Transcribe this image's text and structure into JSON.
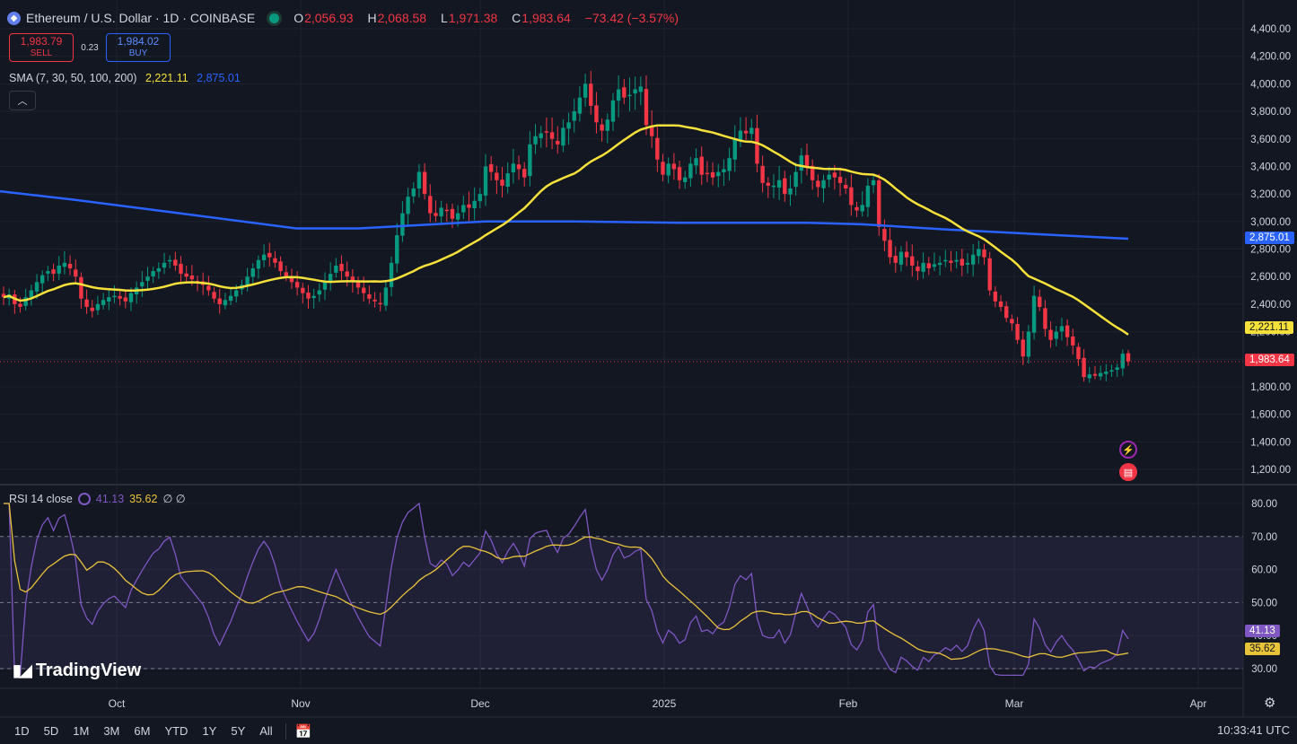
{
  "header": {
    "symbol": "Ethereum / U.S. Dollar · 1D · COINBASE",
    "ohlc": [
      {
        "k": "O",
        "v": "2,056.93"
      },
      {
        "k": "H",
        "v": "2,068.58"
      },
      {
        "k": "L",
        "v": "1,971.38"
      },
      {
        "k": "C",
        "v": "1,983.64"
      },
      {
        "k": "",
        "v": "−73.42 (−3.57%)"
      }
    ]
  },
  "trade": {
    "sell_price": "1,983.79",
    "sell_label": "SELL",
    "spread": "0.23",
    "buy_price": "1,984.02",
    "buy_label": "BUY"
  },
  "sma_legend": {
    "label": "SMA (7, 30, 50, 100, 200)",
    "v1": "2,221.11",
    "v2": "2,875.01"
  },
  "rsi_legend": {
    "label": "RSI 14 close",
    "v1": "41.13",
    "v2": "35.62",
    "extra": "∅ ∅"
  },
  "logo": {
    "text": "TradingView"
  },
  "price_axis": [
    "4,400.00",
    "4,200.00",
    "4,000.00",
    "3,800.00",
    "3,600.00",
    "3,400.00",
    "3,200.00",
    "3,000.00",
    "2,800.00",
    "2,600.00",
    "2,400.00",
    "2,200.00",
    "2,000.00",
    "1,800.00",
    "1,600.00",
    "1,400.00",
    "1,200.00"
  ],
  "rsi_axis": [
    "80.00",
    "70.00",
    "60.00",
    "50.00",
    "40.00",
    "30.00"
  ],
  "time_axis": [
    "Oct",
    "Nov",
    "Dec",
    "2025",
    "Feb",
    "Mar",
    "Apr"
  ],
  "price_badges": {
    "sma_long": "2,875.01",
    "sma_short": "2,221.11",
    "last": "1,983.64"
  },
  "rsi_badges": {
    "rsi": "41.13",
    "ma": "35.62"
  },
  "ranges": [
    "1D",
    "5D",
    "1M",
    "3M",
    "6M",
    "YTD",
    "1Y",
    "5Y",
    "All"
  ],
  "clock": "10:33:41 UTC",
  "colors": {
    "up": "#089981",
    "down": "#f23645",
    "sma_short": "#f5e13a",
    "sma_long": "#2962ff",
    "rsi": "#7e57c2",
    "rsi_ma": "#e8c33a"
  },
  "icons": {
    "collapse": "chevron-up-icon",
    "calendar": "calendar-icon",
    "settings": "settings-icon",
    "flag": "us-flag-icon",
    "bolt": "lightning-icon"
  },
  "chart_data": {
    "type": "candlestick",
    "x_axis": [
      "Oct",
      "Nov",
      "Dec",
      "2025",
      "Feb",
      "Mar",
      "Apr"
    ],
    "y_range": [
      1200,
      4400
    ],
    "daily_closes": [
      2450,
      2470,
      2400,
      2380,
      2450,
      2500,
      2560,
      2610,
      2640,
      2620,
      2680,
      2700,
      2660,
      2600,
      2440,
      2380,
      2350,
      2400,
      2430,
      2450,
      2460,
      2440,
      2420,
      2480,
      2520,
      2560,
      2600,
      2640,
      2660,
      2700,
      2720,
      2680,
      2620,
      2600,
      2580,
      2560,
      2540,
      2500,
      2440,
      2400,
      2430,
      2460,
      2500,
      2540,
      2600,
      2660,
      2720,
      2760,
      2740,
      2700,
      2640,
      2600,
      2560,
      2520,
      2480,
      2440,
      2460,
      2500,
      2560,
      2620,
      2680,
      2640,
      2600,
      2560,
      2520,
      2480,
      2440,
      2420,
      2400,
      2520,
      2700,
      2900,
      3060,
      3180,
      3240,
      3360,
      3200,
      3060,
      3040,
      3100,
      3080,
      3020,
      3060,
      3120,
      3100,
      3150,
      3200,
      3400,
      3360,
      3300,
      3260,
      3350,
      3420,
      3380,
      3320,
      3560,
      3620,
      3640,
      3650,
      3600,
      3560,
      3680,
      3720,
      3800,
      3900,
      4000,
      3840,
      3720,
      3660,
      3740,
      3880,
      3960,
      3900,
      3920,
      3960,
      3980,
      3700,
      3620,
      3450,
      3340,
      3420,
      3380,
      3300,
      3320,
      3420,
      3460,
      3340,
      3350,
      3320,
      3360,
      3380,
      3460,
      3600,
      3660,
      3640,
      3680,
      3420,
      3280,
      3260,
      3260,
      3300,
      3200,
      3240,
      3360,
      3480,
      3400,
      3300,
      3250,
      3300,
      3340,
      3320,
      3280,
      3240,
      3120,
      3080,
      3120,
      3260,
      3300,
      2960,
      2860,
      2740,
      2700,
      2780,
      2740,
      2680,
      2640,
      2700,
      2660,
      2690,
      2700,
      2720,
      2700,
      2720,
      2680,
      2700,
      2760,
      2800,
      2740,
      2500,
      2420,
      2380,
      2300,
      2260,
      2140,
      2020,
      2200,
      2460,
      2380,
      2220,
      2140,
      2200,
      2240,
      2160,
      2100,
      2000,
      1870,
      1890,
      1880,
      1900,
      1910,
      1920,
      1940,
      2040,
      1983.64
    ],
    "series": [
      {
        "name": "SMA 50",
        "last": 2221.11
      },
      {
        "name": "SMA 200",
        "last": 2875.01
      }
    ],
    "rsi": {
      "range": [
        30,
        80
      ],
      "upper_band": 70,
      "lower_band": 30,
      "last": 41.13,
      "ma_last": 35.62
    }
  }
}
